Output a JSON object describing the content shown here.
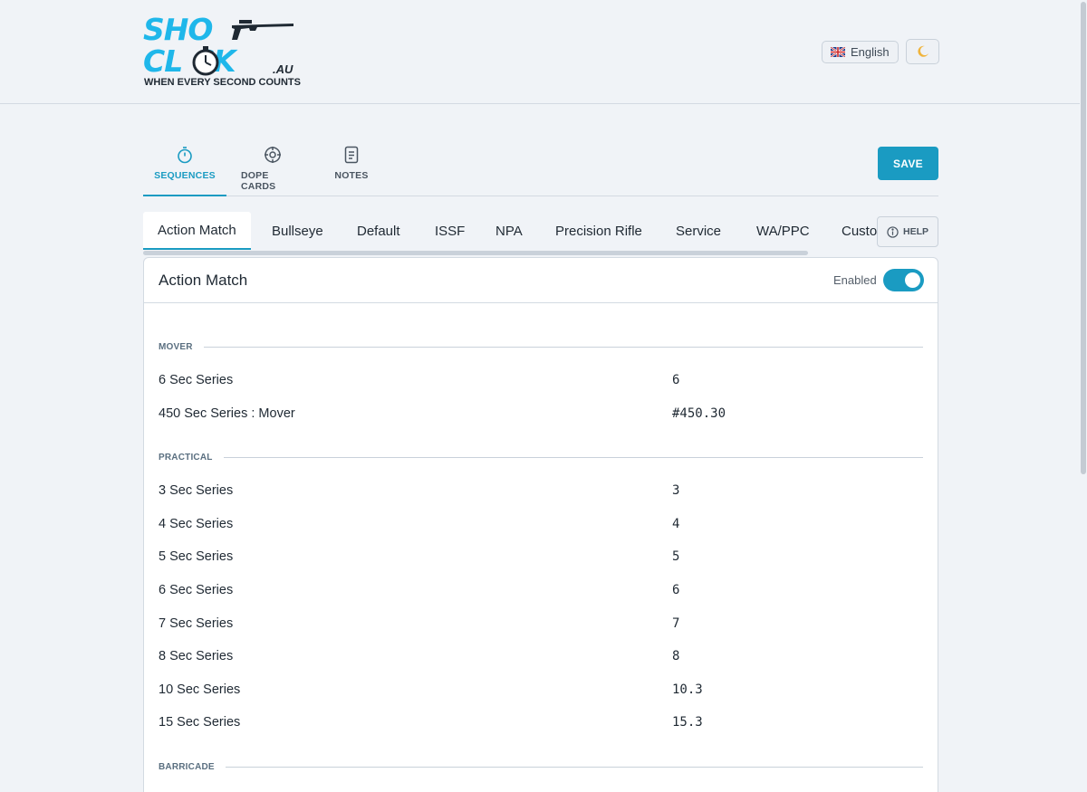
{
  "brand": {
    "line1": "SHO",
    "line2": "CL CK",
    "suffix": ".AU",
    "tagline": "WHEN EVERY SECOND COUNTS"
  },
  "header": {
    "language_label": "English",
    "theme_icon": "moon-icon"
  },
  "main_tabs": [
    {
      "label": "SEQUENCES",
      "icon": "stopwatch-icon",
      "active": true
    },
    {
      "label": "DOPE CARDS",
      "icon": "crosshair-icon",
      "active": false
    },
    {
      "label": "NOTES",
      "icon": "notes-icon",
      "active": false
    }
  ],
  "save_label": "SAVE",
  "profile_tabs": [
    {
      "label": "Action Match",
      "active": true
    },
    {
      "label": "Bullseye"
    },
    {
      "label": "Default"
    },
    {
      "label": "ISSF"
    },
    {
      "label": "NPA"
    },
    {
      "label": "Precision Rifle"
    },
    {
      "label": "Service"
    },
    {
      "label": "WA/PPC"
    },
    {
      "label": "Custom"
    }
  ],
  "help_label": "HELP",
  "card": {
    "title": "Action Match",
    "enabled_label": "Enabled",
    "enabled": true
  },
  "sections": [
    {
      "label": "MOVER",
      "rows": [
        {
          "label": "6 Sec Series",
          "value": "6"
        },
        {
          "label": "450 Sec Series : Mover",
          "value": "#450.30"
        }
      ]
    },
    {
      "label": "PRACTICAL",
      "rows": [
        {
          "label": "3 Sec Series",
          "value": "3"
        },
        {
          "label": "4 Sec Series",
          "value": "4"
        },
        {
          "label": "5 Sec Series",
          "value": "5"
        },
        {
          "label": "6 Sec Series",
          "value": "6"
        },
        {
          "label": "7 Sec Series",
          "value": "7"
        },
        {
          "label": "8 Sec Series",
          "value": "8"
        },
        {
          "label": "10 Sec Series",
          "value": "10.3"
        },
        {
          "label": "15 Sec Series",
          "value": "15.3"
        }
      ]
    },
    {
      "label": "BARRICADE",
      "rows": []
    }
  ],
  "colors": {
    "accent": "#1a9bc2",
    "logo": "#1fb7ea",
    "background": "#f0f3f7"
  }
}
